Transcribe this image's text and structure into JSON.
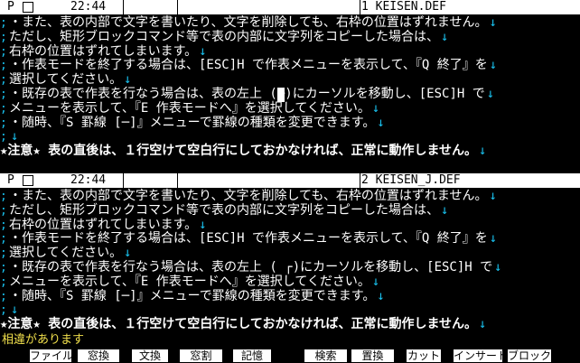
{
  "top_pane": {
    "status": {
      "mode": "P",
      "time": "22:44",
      "file": "1  KEISEN.DEF"
    },
    "lines": [
      {
        "marker": ";",
        "text": "・また、表の内部で文字を書いたり、文字を削除しても、右枠の位置はずれません。",
        "arrow": "↓"
      },
      {
        "marker": ";",
        "text": "  ただし、矩形ブロックコマンド等で表の内部に文字列をコピーした場合は、",
        "arrow": "↓"
      },
      {
        "marker": ";",
        "text": "  右枠の位置はずれてしまいます。",
        "arrow": "↓"
      },
      {
        "marker": ";",
        "text": "・作表モードを終了する場合は、[ESC]H で作表メニューを表示して、『Q 終了』を",
        "arrow": "↓"
      },
      {
        "marker": ";",
        "text": "  選択してください。",
        "arrow": "↓"
      },
      {
        "marker": ";",
        "text_before": "・既存の表で作表を行なう場合は、表の左上 (",
        "cursor": "┌",
        "text_after": ")にカーソルを移動し、[ESC]H で",
        "arrow": "↓"
      },
      {
        "marker": ";",
        "text": "  メニューを表示して、『E 作表モードへ』を選択してください。",
        "arrow": "↓"
      },
      {
        "marker": ";",
        "text": "・随時、『S 罫線 [─]』メニューで罫線の種類を変更できます。",
        "arrow": "↓"
      },
      {
        "marker": ";",
        "text": "",
        "arrow": "↓"
      },
      {
        "marker": "",
        "text": "★注意★  表の直後は、１行空けて空白行にしておかなければ、正常に動作しません。",
        "arrow": "↓",
        "note": true
      }
    ]
  },
  "bottom_pane": {
    "status": {
      "mode": "P",
      "time": "22:44",
      "file": "2  KEISEN_J.DEF"
    },
    "lines": [
      {
        "marker": ";",
        "text": "・また、表の内部で文字を書いたり、文字を削除しても、右枠の位置はずれません。",
        "arrow": "↓"
      },
      {
        "marker": ";",
        "text": "  ただし、矩形ブロックコマンド等で表の内部に文字列をコピーした場合は、",
        "arrow": "↓"
      },
      {
        "marker": ";",
        "text": "  右枠の位置はずれてしまいます。",
        "arrow": "↓"
      },
      {
        "marker": ";",
        "text": "・作表モードを終了する場合は、[ESC]H で作表メニューを表示して、『Q 終了』を",
        "arrow": "↓"
      },
      {
        "marker": ";",
        "text": "  選択してください。",
        "arrow": "↓"
      },
      {
        "marker": ";",
        "text": "・既存の表で作表を行なう場合は、表の左上 ( ┌)にカーソルを移動し、[ESC]H で",
        "arrow": "↓"
      },
      {
        "marker": ";",
        "text": "  メニューを表示して、『E 作表モードへ』を選択してください。",
        "arrow": "↓"
      },
      {
        "marker": ";",
        "text": "・随時、『S 罫線 [─]』メニューで罫線の種類を変更できます。",
        "arrow": "↓"
      },
      {
        "marker": ";",
        "text": "",
        "arrow": "↓"
      },
      {
        "marker": "",
        "text": "★注意★  表の直後は、１行空けて空白行にしておかなければ、正常に動作しません。",
        "arrow": "↓",
        "note": true
      }
    ]
  },
  "message": "相違があります",
  "function_keys": [
    "ファイル",
    "窓換",
    "文換",
    "窓割",
    "記憶",
    "",
    "検索",
    "置換",
    "カット",
    "インサート",
    "ブロック"
  ],
  "colors": {
    "background": "#000000",
    "text": "#ffffff",
    "marker": "#19c1ee",
    "message": "#f1e04c",
    "bar": "#ffffff"
  }
}
